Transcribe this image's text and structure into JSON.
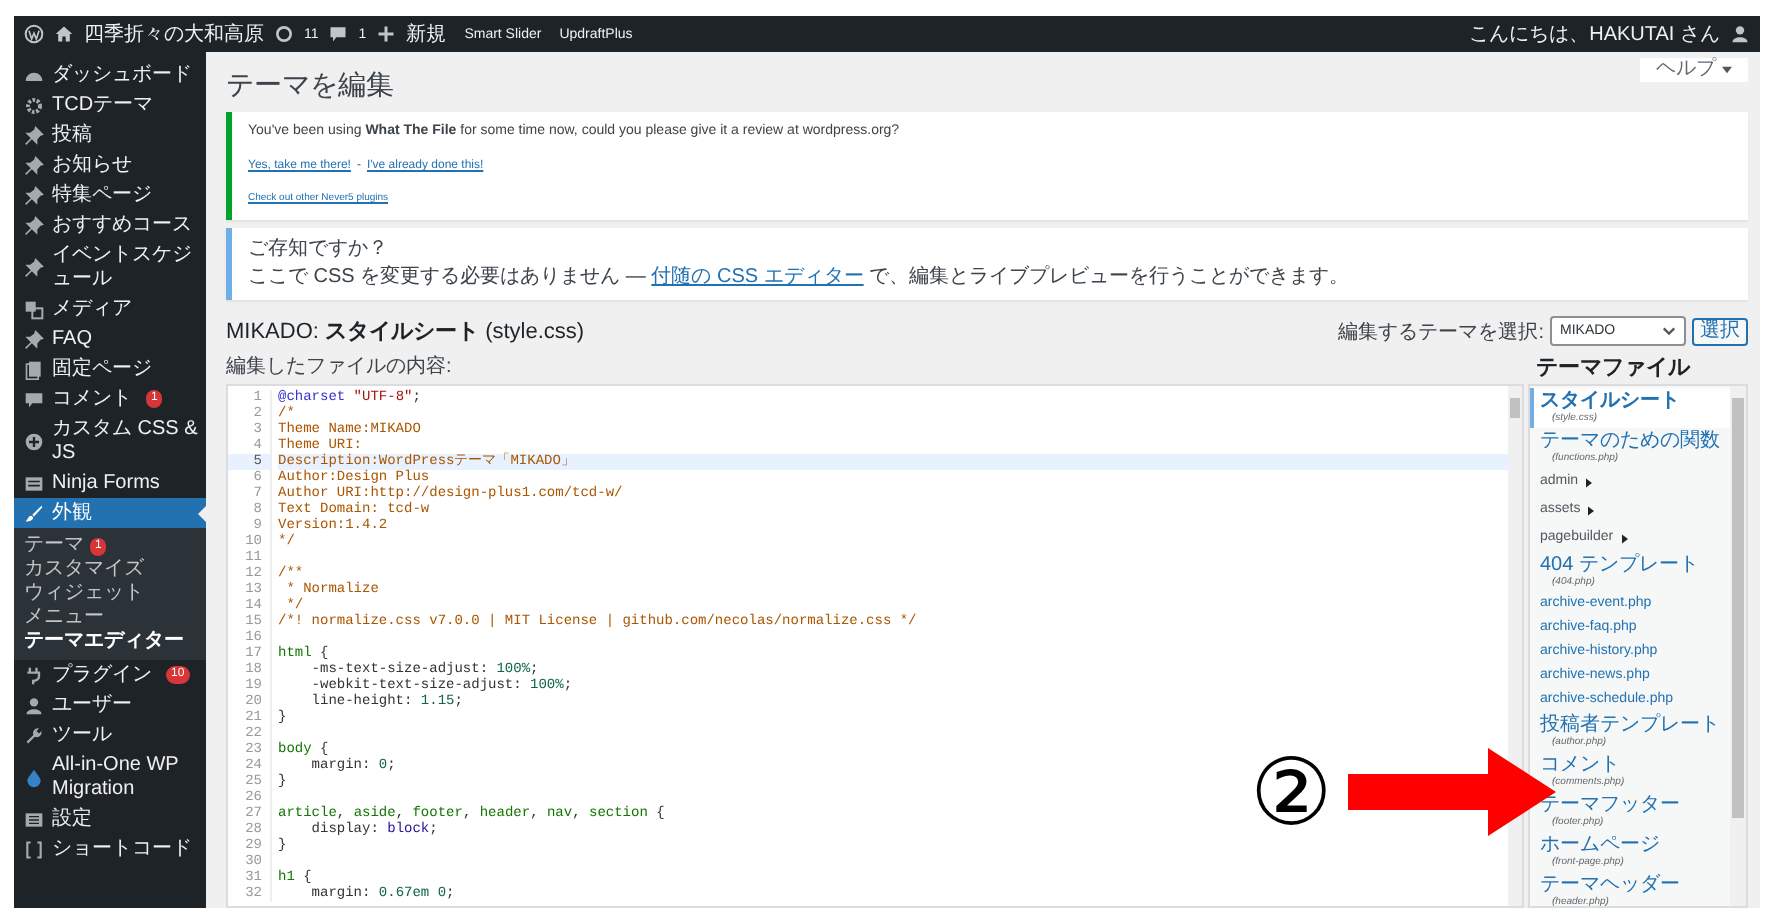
{
  "admin_bar": {
    "site_name": "四季折々の大和高原",
    "updates": "11",
    "comments": "1",
    "new_label": "新規",
    "items": [
      "Smart Slider",
      "UpdraftPlus"
    ],
    "greeting": "こんにちは、HAKUTAI さん"
  },
  "sidebar": {
    "items": [
      {
        "label": "ダッシュボード",
        "selected": false
      },
      {
        "label": "TCDテーマ",
        "selected": false
      },
      {
        "label": "投稿",
        "selected": false
      },
      {
        "label": "お知らせ",
        "selected": false
      },
      {
        "label": "特集ページ",
        "selected": false
      },
      {
        "label": "おすすめコース",
        "selected": false
      },
      {
        "label": "イベントスケジュール",
        "selected": false
      },
      {
        "label": "メディア",
        "selected": false
      },
      {
        "label": "FAQ",
        "selected": false
      },
      {
        "label": "固定ページ",
        "selected": false
      },
      {
        "label": "コメント",
        "badge": "1",
        "selected": false
      },
      {
        "label": "カスタム CSS & JS",
        "selected": false
      },
      {
        "label": "Ninja Forms",
        "selected": false
      },
      {
        "label": "外観",
        "selected": true,
        "children": [
          {
            "label": "テーマ",
            "badge": "1",
            "selected": false
          },
          {
            "label": "カスタマイズ",
            "selected": false
          },
          {
            "label": "ウィジェット",
            "selected": false
          },
          {
            "label": "メニュー",
            "selected": false
          },
          {
            "label": "テーマエディター",
            "selected": true
          }
        ]
      },
      {
        "label": "プラグイン",
        "badge": "10",
        "selected": false
      },
      {
        "label": "ユーザー",
        "selected": false
      },
      {
        "label": "ツール",
        "selected": false
      },
      {
        "label": "All-in-One WP Migration",
        "selected": false
      },
      {
        "label": "設定",
        "selected": false
      },
      {
        "label": "ショートコード",
        "selected": false
      }
    ]
  },
  "help_button": "ヘルプ",
  "page_title": "テーマを編集",
  "notices": [
    {
      "kind": "success",
      "text": "You've been using **What The File** for some time now, could you please give it a review at wordpress.org?",
      "links": [
        "Yes, take me there!",
        "I've already done this!"
      ],
      "link_separator": "-",
      "footer_link": "Check out other Never5 plugins"
    },
    {
      "kind": "info",
      "title": "ご存知ですか？",
      "text_before": "ここで CSS を変更する必要はありません — ",
      "link": "付随の CSS エディター",
      "text_after": " で、編集とライブプレビューを行うことができます。"
    }
  ],
  "file_heading": "MIKADO: **スタイルシート** (style.css)",
  "theme_select": {
    "label": "編集するテーマを選択:",
    "value": "MIKADO",
    "button": "選択"
  },
  "editor": {
    "label": "編集したファイルの内容:",
    "lines": [
      {
        "num": "1",
        "selected": false,
        "tokens": [
          {
            "kind": "atrule",
            "text": "@charset"
          },
          {
            "kind": "string",
            "text": " \"UTF-8\""
          },
          {
            "kind": "plain",
            "text": ";"
          }
        ]
      },
      {
        "num": "2",
        "selected": false,
        "tokens": [
          {
            "kind": "comment",
            "text": "/*"
          }
        ]
      },
      {
        "num": "3",
        "selected": false,
        "tokens": [
          {
            "kind": "comment",
            "text": "Theme Name:MIKADO"
          }
        ]
      },
      {
        "num": "4",
        "selected": false,
        "tokens": [
          {
            "kind": "comment",
            "text": "Theme URI:"
          }
        ]
      },
      {
        "num": "5",
        "selected": true,
        "tokens": [
          {
            "kind": "comment",
            "text": "Description:WordPressテーマ「MIKADO」"
          }
        ]
      },
      {
        "num": "6",
        "selected": false,
        "tokens": [
          {
            "kind": "comment",
            "text": "Author:Design Plus"
          }
        ]
      },
      {
        "num": "7",
        "selected": false,
        "tokens": [
          {
            "kind": "comment",
            "text": "Author URI:http://design-plus1.com/tcd-w/"
          }
        ]
      },
      {
        "num": "8",
        "selected": false,
        "tokens": [
          {
            "kind": "comment",
            "text": "Text Domain: tcd-w"
          }
        ]
      },
      {
        "num": "9",
        "selected": false,
        "tokens": [
          {
            "kind": "comment",
            "text": "Version:1.4.2"
          }
        ]
      },
      {
        "num": "10",
        "selected": false,
        "tokens": [
          {
            "kind": "comment",
            "text": "*/"
          }
        ]
      },
      {
        "num": "11",
        "selected": false
      },
      {
        "num": "12",
        "selected": false,
        "tokens": [
          {
            "kind": "comment",
            "text": "/**"
          }
        ]
      },
      {
        "num": "13",
        "selected": false,
        "tokens": [
          {
            "kind": "comment",
            "text": " * Normalize"
          }
        ]
      },
      {
        "num": "14",
        "selected": false,
        "tokens": [
          {
            "kind": "comment",
            "text": " */"
          }
        ]
      },
      {
        "num": "15",
        "selected": false,
        "tokens": [
          {
            "kind": "comment",
            "text": "/*! normalize.css v7.0.0 | MIT License | github.com/necolas/normalize.css */"
          }
        ]
      },
      {
        "num": "16",
        "selected": false
      },
      {
        "num": "17",
        "selected": false,
        "tokens": [
          {
            "kind": "selector",
            "text": "html"
          },
          {
            "kind": "plain",
            "text": " {"
          }
        ]
      },
      {
        "num": "18",
        "selected": false,
        "tokens": [
          {
            "kind": "property",
            "text": "    -ms-text-size-adjust"
          },
          {
            "kind": "plain",
            "text": ": "
          },
          {
            "kind": "number",
            "text": "100%"
          },
          {
            "kind": "plain",
            "text": ";"
          }
        ]
      },
      {
        "num": "19",
        "selected": false,
        "tokens": [
          {
            "kind": "property",
            "text": "    -webkit-text-size-adjust"
          },
          {
            "kind": "plain",
            "text": ": "
          },
          {
            "kind": "number",
            "text": "100%"
          },
          {
            "kind": "plain",
            "text": ";"
          }
        ]
      },
      {
        "num": "20",
        "selected": false,
        "tokens": [
          {
            "kind": "property",
            "text": "    line-height"
          },
          {
            "kind": "plain",
            "text": ": "
          },
          {
            "kind": "number",
            "text": "1.15"
          },
          {
            "kind": "plain",
            "text": ";"
          }
        ]
      },
      {
        "num": "21",
        "selected": false,
        "tokens": [
          {
            "kind": "plain",
            "text": "}"
          }
        ]
      },
      {
        "num": "22",
        "selected": false
      },
      {
        "num": "23",
        "selected": false,
        "tokens": [
          {
            "kind": "selector",
            "text": "body"
          },
          {
            "kind": "plain",
            "text": " {"
          }
        ]
      },
      {
        "num": "24",
        "selected": false,
        "tokens": [
          {
            "kind": "property",
            "text": "    margin"
          },
          {
            "kind": "plain",
            "text": ": "
          },
          {
            "kind": "number",
            "text": "0"
          },
          {
            "kind": "plain",
            "text": ";"
          }
        ]
      },
      {
        "num": "25",
        "selected": false,
        "tokens": [
          {
            "kind": "plain",
            "text": "}"
          }
        ]
      },
      {
        "num": "26",
        "selected": false
      },
      {
        "num": "27",
        "selected": false,
        "tokens": [
          {
            "kind": "selector",
            "text": "article"
          },
          {
            "kind": "plain",
            "text": ", "
          },
          {
            "kind": "selector",
            "text": "aside"
          },
          {
            "kind": "plain",
            "text": ", "
          },
          {
            "kind": "selector",
            "text": "footer"
          },
          {
            "kind": "plain",
            "text": ", "
          },
          {
            "kind": "selector",
            "text": "header"
          },
          {
            "kind": "plain",
            "text": ", "
          },
          {
            "kind": "selector",
            "text": "nav"
          },
          {
            "kind": "plain",
            "text": ", "
          },
          {
            "kind": "selector",
            "text": "section"
          },
          {
            "kind": "plain",
            "text": " {"
          }
        ]
      },
      {
        "num": "28",
        "selected": false,
        "tokens": [
          {
            "kind": "property",
            "text": "    display"
          },
          {
            "kind": "plain",
            "text": ": "
          },
          {
            "kind": "value",
            "text": "block"
          },
          {
            "kind": "plain",
            "text": ";"
          }
        ]
      },
      {
        "num": "29",
        "selected": false,
        "tokens": [
          {
            "kind": "plain",
            "text": "}"
          }
        ]
      },
      {
        "num": "30",
        "selected": false
      },
      {
        "num": "31",
        "selected": false,
        "tokens": [
          {
            "kind": "selector",
            "text": "h1"
          },
          {
            "kind": "plain",
            "text": " {"
          }
        ]
      },
      {
        "num": "32",
        "selected": false,
        "tokens": [
          {
            "kind": "property",
            "text": "    margin"
          },
          {
            "kind": "plain",
            "text": ": "
          },
          {
            "kind": "number",
            "text": "0.67em 0"
          },
          {
            "kind": "plain",
            "text": ";"
          }
        ]
      }
    ]
  },
  "theme_files": {
    "title": "テーマファイル",
    "items": [
      {
        "kind": "file",
        "label": "スタイルシート",
        "file": "(style.css)",
        "selected": true
      },
      {
        "kind": "file",
        "label": "テーマのための関数",
        "file": "(functions.php)",
        "selected": false
      },
      {
        "kind": "folder",
        "label": "admin",
        "selected": false
      },
      {
        "kind": "folder",
        "label": "assets",
        "selected": false
      },
      {
        "kind": "folder",
        "label": "pagebuilder",
        "selected": false
      },
      {
        "kind": "file",
        "label": "404 テンプレート",
        "file": "(404.php)",
        "selected": false
      },
      {
        "kind": "file",
        "label": "archive-event.php",
        "selected": false
      },
      {
        "kind": "file",
        "label": "archive-faq.php",
        "selected": false
      },
      {
        "kind": "file",
        "label": "archive-history.php",
        "selected": false
      },
      {
        "kind": "file",
        "label": "archive-news.php",
        "selected": false
      },
      {
        "kind": "file",
        "label": "archive-schedule.php",
        "selected": false
      },
      {
        "kind": "file",
        "label": "投稿者テンプレート",
        "file": "(author.php)",
        "selected": false
      },
      {
        "kind": "file",
        "label": "コメント",
        "file": "(comments.php)",
        "selected": false
      },
      {
        "kind": "file",
        "label": "テーマフッター",
        "file": "(footer.php)",
        "selected": false
      },
      {
        "kind": "file",
        "label": "ホームページ",
        "file": "(front-page.php)",
        "selected": false
      },
      {
        "kind": "file",
        "label": "テーマヘッダー",
        "file": "(header.php)",
        "selected": false
      }
    ]
  },
  "annotation": {
    "marker": "②"
  }
}
